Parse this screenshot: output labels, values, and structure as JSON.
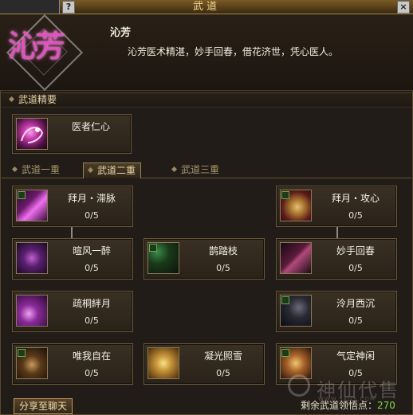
{
  "window": {
    "title": "武道",
    "help_label": "?",
    "close_label": "×"
  },
  "header": {
    "emblem_text": "沁芳",
    "name": "沁芳",
    "description": "沁芳医术精湛，妙手回春，借花济世，凭心医人。"
  },
  "section": {
    "label": "武道精要"
  },
  "essence_skill": {
    "name": "医者仁心",
    "icon": "pink-dragon-icon"
  },
  "tabs": [
    {
      "label": "武道一重",
      "active": false
    },
    {
      "label": "武道二重",
      "active": true
    },
    {
      "label": "武道三重",
      "active": false
    }
  ],
  "skills": [
    {
      "name": "拜月・滞脉",
      "progress": "0/5",
      "icon": "pink-slash-icon"
    },
    {
      "name": "拜月・攻心",
      "progress": "0/5",
      "icon": "golden-shell-icon"
    },
    {
      "name": "暄风一醉",
      "progress": "0/5",
      "icon": "purple-mist-icon"
    },
    {
      "name": "鹊踏枝",
      "progress": "0/5",
      "icon": "green-crescent-icon"
    },
    {
      "name": "妙手回春",
      "progress": "0/5",
      "icon": "dark-blades-icon"
    },
    {
      "name": "疏桐絆月",
      "progress": "0/5",
      "icon": "violet-burst-icon"
    },
    {
      "name": "泠月西沉",
      "progress": "0/5",
      "icon": "shadow-arc-icon"
    },
    {
      "name": "唯我自在",
      "progress": "0/5",
      "icon": "warrior-figure-icon"
    },
    {
      "name": "凝光照雪",
      "progress": "0/5",
      "icon": "golden-glow-icon"
    },
    {
      "name": "气定神闲",
      "progress": "0/5",
      "icon": "golden-lotus-icon"
    }
  ],
  "footer": {
    "share_label": "分享至聊天",
    "remaining_label": "剩余武道领悟点：",
    "remaining_points": "270",
    "watermark_text": "神仙代售",
    "watermark_url": "WWW.SXDS.COM"
  },
  "colors": {
    "accent": "#e050c0",
    "points": "#7ad84a",
    "title": "#f0d890"
  }
}
